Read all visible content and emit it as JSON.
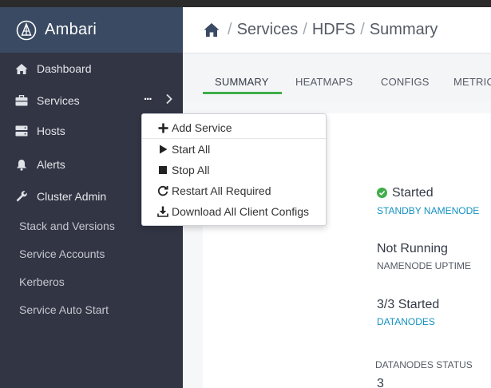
{
  "app": {
    "name": "Ambari"
  },
  "sidebar": {
    "items": [
      {
        "label": "Dashboard",
        "icon": "home-icon"
      },
      {
        "label": "Services",
        "icon": "briefcase-icon",
        "more": "..."
      },
      {
        "label": "Hosts",
        "icon": "server-icon"
      },
      {
        "label": "Alerts",
        "icon": "bell-icon"
      },
      {
        "label": "Cluster Admin",
        "icon": "wrench-icon"
      }
    ],
    "subitems": [
      "Stack and Versions",
      "Service Accounts",
      "Kerberos",
      "Service Auto Start"
    ]
  },
  "breadcrumb": {
    "separator": "/",
    "items": [
      "Services",
      "HDFS",
      "Summary"
    ]
  },
  "tabs": [
    "SUMMARY",
    "HEATMAPS",
    "CONFIGS",
    "METRIC"
  ],
  "active_tab": "SUMMARY",
  "summary": {
    "namenode_status": "Started",
    "standby_link": "STANDBY NAMENODE",
    "uptime_value": "Not Running",
    "uptime_label": "NAMENODE UPTIME",
    "datanodes_value": "3/3 Started",
    "datanodes_link": "DATANODES",
    "datanodes_status_label": "DATANODES STATUS",
    "datanodes_status_value": "3"
  },
  "services_menu": {
    "items": [
      {
        "label": "Add Service",
        "icon": "plus-icon"
      },
      {
        "label": "Start All",
        "icon": "play-icon"
      },
      {
        "label": "Stop All",
        "icon": "stop-icon"
      },
      {
        "label": "Restart All Required",
        "icon": "refresh-icon"
      },
      {
        "label": "Download All Client Configs",
        "icon": "download-icon"
      }
    ]
  },
  "colors": {
    "sidebar_bg": "#323544",
    "brand_bg": "#3a4a63",
    "accent_green": "#3fae49",
    "link_blue": "#1491c1"
  }
}
